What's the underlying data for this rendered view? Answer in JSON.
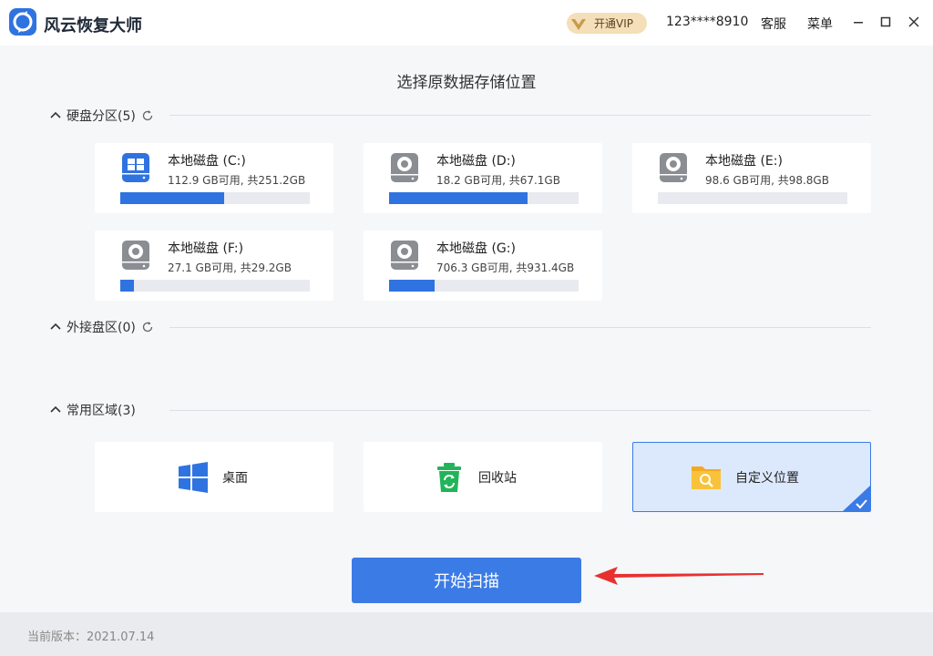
{
  "app": {
    "title": "风云恢复大师",
    "brand_color": "#2f73e0"
  },
  "topbar": {
    "vip_label": "开通VIP",
    "user_id": "123****8910",
    "service_label": "客服",
    "menu_label": "菜单",
    "window_controls": [
      "minimize-icon",
      "maximize-icon",
      "close-icon"
    ]
  },
  "main": {
    "title": "选择原数据存储位置",
    "sections": {
      "disks": {
        "label": "硬盘分区(5)"
      },
      "external": {
        "label": "外接盘区(0)"
      },
      "common": {
        "label": "常用区域(3)"
      }
    }
  },
  "drives": [
    {
      "name": "本地磁盘 (C:)",
      "capacity": "112.9 GB可用, 共251.2GB",
      "used_fraction": 0.55,
      "icon": "windows-drive-icon"
    },
    {
      "name": "本地磁盘 (D:)",
      "capacity": "18.2 GB可用, 共67.1GB",
      "used_fraction": 0.73,
      "icon": "hard-drive-icon"
    },
    {
      "name": "本地磁盘 (E:)",
      "capacity": "98.6 GB可用, 共98.8GB",
      "used_fraction": 0.0,
      "icon": "hard-drive-icon"
    },
    {
      "name": "本地磁盘 (F:)",
      "capacity": "27.1 GB可用, 共29.2GB",
      "used_fraction": 0.07,
      "icon": "hard-drive-icon"
    },
    {
      "name": "本地磁盘 (G:)",
      "capacity": "706.3 GB可用, 共931.4GB",
      "used_fraction": 0.24,
      "icon": "hard-drive-icon"
    }
  ],
  "common_areas": [
    {
      "label": "桌面",
      "icon": "windows-logo-icon",
      "selected": false
    },
    {
      "label": "回收站",
      "icon": "recycle-bin-icon",
      "selected": false
    },
    {
      "label": "自定义位置",
      "icon": "folder-search-icon",
      "selected": true
    }
  ],
  "scan_button": {
    "label": "开始扫描"
  },
  "footer": {
    "version_text": "当前版本：2021.07.14"
  },
  "colors": {
    "accent": "#3b7be6",
    "selected_bg": "#dce9fc",
    "vip_bg": "#f4dfb8",
    "arrow": "#e8312f"
  }
}
